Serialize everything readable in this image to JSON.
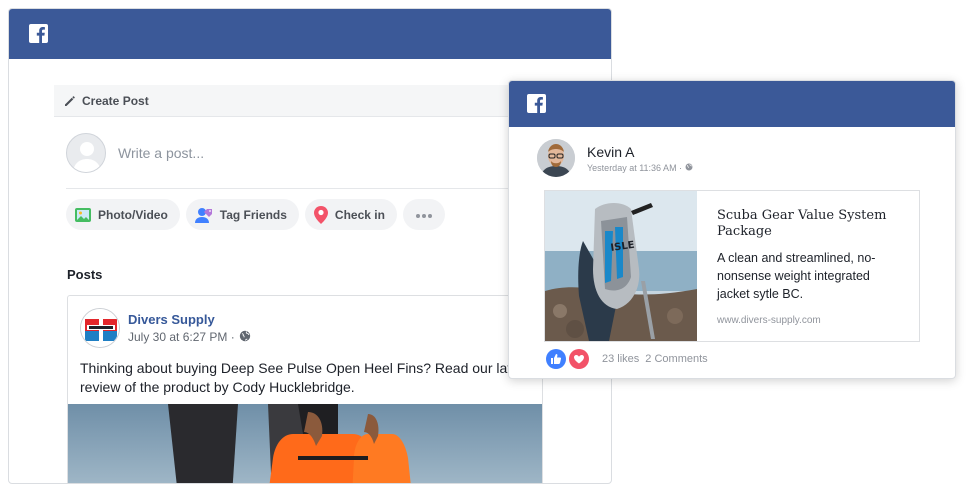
{
  "colors": {
    "fb_blue": "#3b5998",
    "link_blue": "#365899",
    "like_blue": "#4080ff",
    "love_red": "#f25268"
  },
  "create_post": {
    "header_label": "Create Post",
    "placeholder": "Write a post...",
    "actions": [
      {
        "label": "Photo/Video",
        "icon": "photo-icon"
      },
      {
        "label": "Tag Friends",
        "icon": "tag-friends-icon"
      },
      {
        "label": "Check in",
        "icon": "location-pin-icon"
      }
    ],
    "more_icon": "more-dots-icon"
  },
  "posts": {
    "section_label": "Posts",
    "items": [
      {
        "author": "Divers Supply",
        "time": "July 30 at 6:27 PM ·",
        "privacy_icon": "globe-icon",
        "text": "Thinking about buying Deep See Pulse Open Heel Fins? Read our latest review of the product by Cody Hucklebridge."
      }
    ]
  },
  "shared_post": {
    "author": "Kevin A",
    "time": "Yesterday at 11:36 AM ·",
    "link": {
      "title": "Scuba Gear Value System Package",
      "description": "A clean and streamlined, no-nonsense weight integrated jacket sytle BC.",
      "url": "www.divers-supply.com"
    },
    "likes": "23 likes",
    "comments": "2 Comments"
  }
}
